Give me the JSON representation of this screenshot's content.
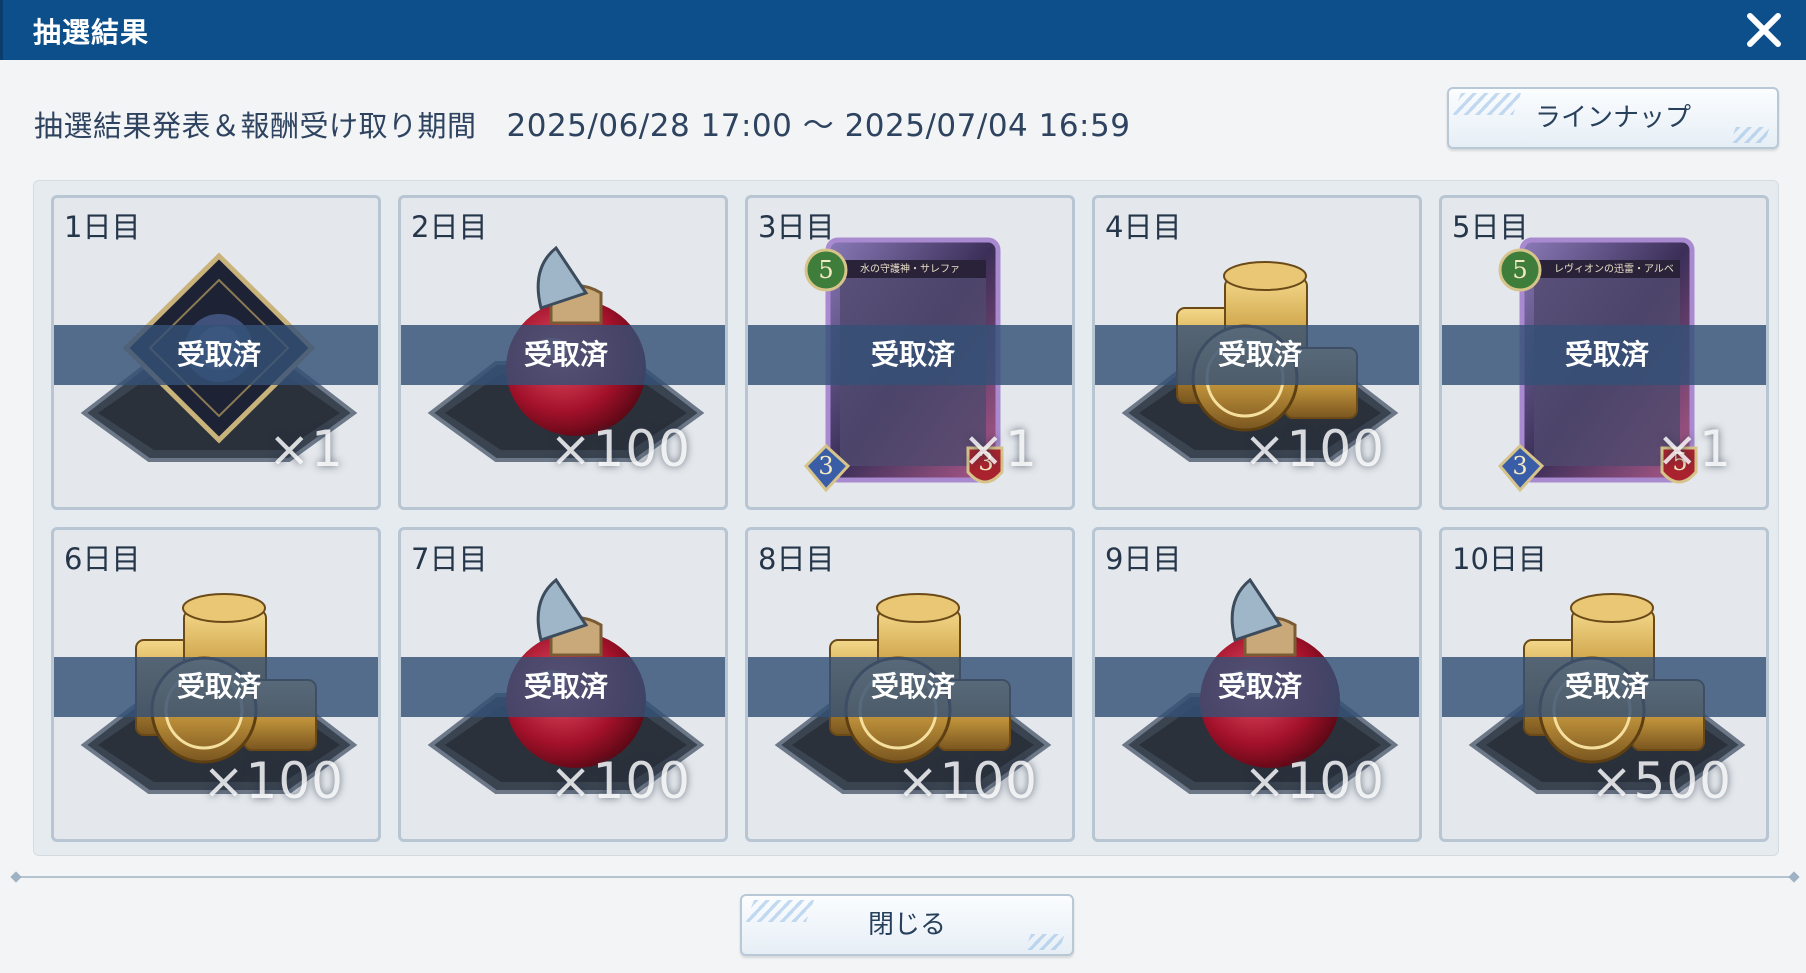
{
  "dialog": {
    "title": "抽選結果",
    "close_icon": "close-icon"
  },
  "period": {
    "label": "抽選結果発表＆報酬受け取り期間",
    "dates": "2025/06/28 17:00 ～ 2025/07/04 16:59"
  },
  "lineup_button": {
    "label": "ラインナップ"
  },
  "close_button": {
    "label": "閉じる"
  },
  "claimed_label": "受取済",
  "days": [
    {
      "label": "1日目",
      "item": "card-sleeve",
      "qty": "×1",
      "claimed": "受取済"
    },
    {
      "label": "2日目",
      "item": "red-potion",
      "qty": "×100",
      "claimed": "受取済"
    },
    {
      "label": "3日目",
      "item": "card",
      "qty": "×1",
      "claimed": "受取済",
      "card_name": "水の守護神・サレファ",
      "cost": "5",
      "atk": "3",
      "def": "3"
    },
    {
      "label": "4日目",
      "item": "gold-coins",
      "qty": "×100",
      "claimed": "受取済"
    },
    {
      "label": "5日目",
      "item": "card",
      "qty": "×1",
      "claimed": "受取済",
      "card_name": "レヴィオンの迅雷・アルベール",
      "cost": "5",
      "atk": "3",
      "def": "5"
    },
    {
      "label": "6日目",
      "item": "gold-coins",
      "qty": "×100",
      "claimed": "受取済"
    },
    {
      "label": "7日目",
      "item": "red-potion",
      "qty": "×100",
      "claimed": "受取済"
    },
    {
      "label": "8日目",
      "item": "gold-coins",
      "qty": "×100",
      "claimed": "受取済"
    },
    {
      "label": "9日目",
      "item": "red-potion",
      "qty": "×100",
      "claimed": "受取済"
    },
    {
      "label": "10日目",
      "item": "gold-coins",
      "qty": "×500",
      "claimed": "受取済"
    }
  ],
  "colors": {
    "titlebar": "#0c4f8b",
    "band": "#345076",
    "text": "#26364a"
  }
}
